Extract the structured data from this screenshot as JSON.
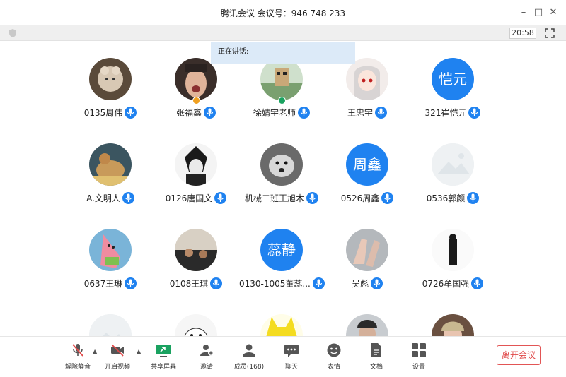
{
  "window": {
    "title": "腾讯会议 会议号：946 748 233",
    "minimize_glyph": "–",
    "maximize_glyph": "□",
    "close_glyph": "✕"
  },
  "status_bar": {
    "clock": "20:58"
  },
  "speaking_label": "正在讲话:",
  "participants": [
    {
      "name": "0135周伟",
      "avatar": "photo-cat-costume"
    },
    {
      "name": "张福鑫",
      "avatar": "photo-face"
    },
    {
      "name": "徐婧宇老师",
      "avatar": "photo-toy"
    },
    {
      "name": "王忠宇",
      "avatar": "photo-anime"
    },
    {
      "name": "321崔恺元",
      "avatar_text": "恺元"
    },
    {
      "name": "A.文明人",
      "avatar": "photo-cartoon-mouse"
    },
    {
      "name": "0126唐国文",
      "avatar": "photo-bw-anime"
    },
    {
      "name": "机械二班王旭木",
      "avatar": "photo-dog"
    },
    {
      "name": "0526周鑫",
      "avatar_text": "周鑫"
    },
    {
      "name": "0536郭颜",
      "avatar": "placeholder-image"
    },
    {
      "name": "0637王琳",
      "avatar": "photo-patrick"
    },
    {
      "name": "0108王琪",
      "avatar": "photo-room"
    },
    {
      "name": "0130-1005董蕊...",
      "avatar_text": "蕊静"
    },
    {
      "name": "吴彪",
      "avatar": "photo-hands"
    },
    {
      "name": "0726牟国强",
      "avatar": "photo-sketch"
    },
    {
      "name": "",
      "avatar": "placeholder-image"
    },
    {
      "name": "",
      "avatar": "photo-cartoon-white"
    },
    {
      "name": "",
      "avatar": "photo-yellow-cartoon"
    },
    {
      "name": "",
      "avatar": "photo-person-dark"
    },
    {
      "name": "",
      "avatar": "photo-person-light"
    }
  ],
  "toolbar": {
    "unmute": "解除静音",
    "start_video": "开启视频",
    "share_screen": "共享屏幕",
    "invite": "邀请",
    "members": "成员(168)",
    "chat": "聊天",
    "emoji": "表情",
    "docs": "文档",
    "settings": "设置",
    "leave": "离开会议"
  },
  "colors": {
    "accent": "#1f82f0",
    "leave": "#e04848",
    "share": "#1aa260"
  }
}
